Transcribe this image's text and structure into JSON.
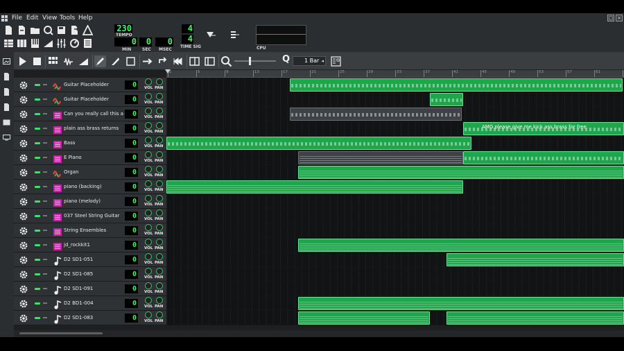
{
  "menu": {
    "file": "File",
    "edit": "Edit",
    "view": "View",
    "tools": "Tools",
    "help": "Help"
  },
  "transport": {
    "tempo": "230",
    "tempo_label": "TEMPO",
    "min": "0",
    "sec": "0",
    "msec": "0",
    "min_label": "MIN",
    "sec_label": "SEC",
    "msec_label": "MSEC",
    "timesig_num": "4",
    "timesig_den": "4",
    "timesig_label": "TIME SIG",
    "cpu_label": "CPU"
  },
  "editor": {
    "quantize": "1 Bar"
  },
  "ruler": [
    "1",
    "5",
    "9",
    "13",
    "17",
    "21",
    "25",
    "29",
    "33",
    "37",
    "41",
    "45",
    "49",
    "53",
    "57",
    "61",
    "65"
  ],
  "knob_labels": {
    "vol": "VOL",
    "pan": "PAN"
  },
  "tracks": [
    {
      "name": "Guitar Placeholder",
      "vol": "0",
      "icon": "tripleoscillator-icon"
    },
    {
      "name": "Guitar Placeholder",
      "vol": "0",
      "icon": "tripleoscillator-icon"
    },
    {
      "name": "Can you really call this a hihat",
      "vol": "0",
      "icon": "soundfont-icon"
    },
    {
      "name": "plain ass brass returns",
      "vol": "0",
      "icon": "soundfont-icon"
    },
    {
      "name": "Bass",
      "vol": "0",
      "icon": "soundfont-icon"
    },
    {
      "name": "E Piano",
      "vol": "0",
      "icon": "soundfont-icon"
    },
    {
      "name": "Organ",
      "vol": "0",
      "icon": "tripleoscillator-icon"
    },
    {
      "name": "piano (backing)",
      "vol": "0",
      "icon": "soundfont-icon"
    },
    {
      "name": "piano (melody)",
      "vol": "0",
      "icon": "soundfont-icon"
    },
    {
      "name": "037 Steel String Guitar",
      "vol": "0",
      "icon": "soundfont-icon"
    },
    {
      "name": "String Ensembles",
      "vol": "0",
      "icon": "soundfont-icon"
    },
    {
      "name": "jd_rockkit1",
      "vol": "0",
      "icon": "soundfont-icon"
    },
    {
      "name": "D2 SD1-051",
      "vol": "0",
      "icon": "sample-icon"
    },
    {
      "name": "D2 SD1-085",
      "vol": "0",
      "icon": "sample-icon"
    },
    {
      "name": "D2 SD1-091",
      "vol": "0",
      "icon": "sample-icon"
    },
    {
      "name": "D2 BD1-004",
      "vol": "0",
      "icon": "sample-icon"
    },
    {
      "name": "D2 SD1-083",
      "vol": "0",
      "icon": "sample-icon"
    }
  ],
  "clip_label_brass": "AMG please give me kick ass brass for free",
  "colors": {
    "accent": "#3df56b",
    "clip": "#1fa64c",
    "clip_border": "#6ee38f",
    "soundfont": "#c81ea8",
    "tripleosc": "#d23a3a"
  }
}
